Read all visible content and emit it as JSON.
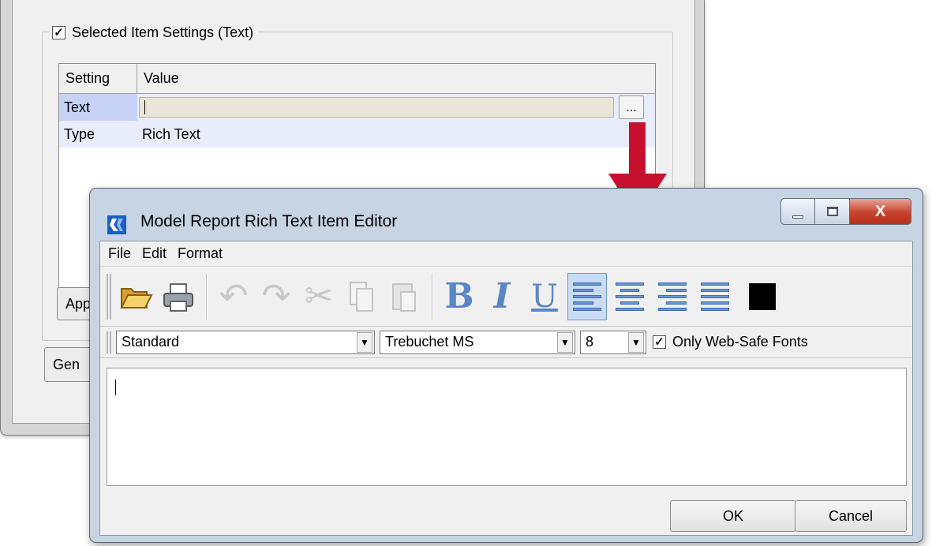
{
  "background_dialog": {
    "group_title": "Selected Item Settings (Text)",
    "group_checked": true,
    "table": {
      "columns": [
        "Setting",
        "Value"
      ],
      "rows": [
        {
          "setting": "Text",
          "value": ""
        },
        {
          "setting": "Type",
          "value": "Rich Text"
        }
      ],
      "ellipsis_label": "..."
    },
    "apply_button_partial": "App",
    "general_button_partial": "Gen"
  },
  "editor": {
    "title": "Model Report Rich Text Item Editor",
    "window_controls": {
      "close_label": "X"
    },
    "menu": [
      "File",
      "Edit",
      "Format"
    ],
    "toolbar": {
      "icons": [
        "open-folder-icon",
        "print-icon",
        "undo-icon",
        "redo-icon",
        "cut-icon",
        "copy-icon",
        "paste-icon",
        "bold-icon",
        "italic-icon",
        "underline-icon",
        "align-left-icon",
        "align-center-icon",
        "align-right-icon",
        "align-justify-icon",
        "text-color-icon"
      ],
      "bold_glyph": "B",
      "italic_glyph": "I",
      "underline_glyph": "U",
      "text_color": "#000000"
    },
    "font_bar": {
      "style": "Standard",
      "font": "Trebuchet MS",
      "size": "8",
      "web_safe_label": "Only Web-Safe Fonts",
      "web_safe_checked": true
    },
    "content": "",
    "ok_label": "OK",
    "cancel_label": "Cancel"
  },
  "colors": {
    "arrow": "#c8102e",
    "selected_row": "#c6d3f7",
    "text_field": "#eae6d7"
  }
}
